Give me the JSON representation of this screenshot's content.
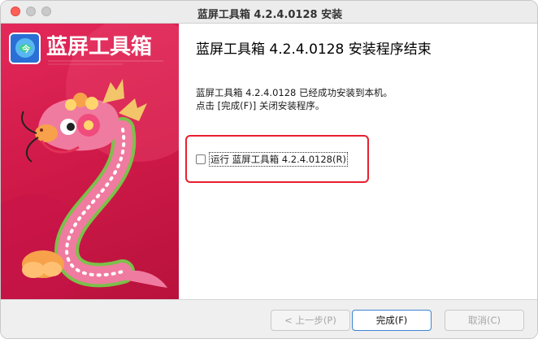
{
  "window": {
    "title": "蓝屏工具箱 4.2.4.0128 安装"
  },
  "sidebar": {
    "brand_text": "蓝屏工具箱",
    "brand_color": "#d11a49"
  },
  "main": {
    "heading": "蓝屏工具箱 4.2.4.0128 安装程序结束",
    "desc_line1": "蓝屏工具箱 4.2.4.0128 已经成功安装到本机。",
    "desc_line2": "点击 [完成(F)] 关闭安装程序。",
    "run_checkbox_label": "运行 蓝屏工具箱 4.2.4.0128(R)",
    "run_checkbox_checked": false,
    "highlight_color": "#e8202e"
  },
  "footer": {
    "back_label": "< 上一步(P)",
    "finish_label": "完成(F)",
    "cancel_label": "取消(C)"
  }
}
